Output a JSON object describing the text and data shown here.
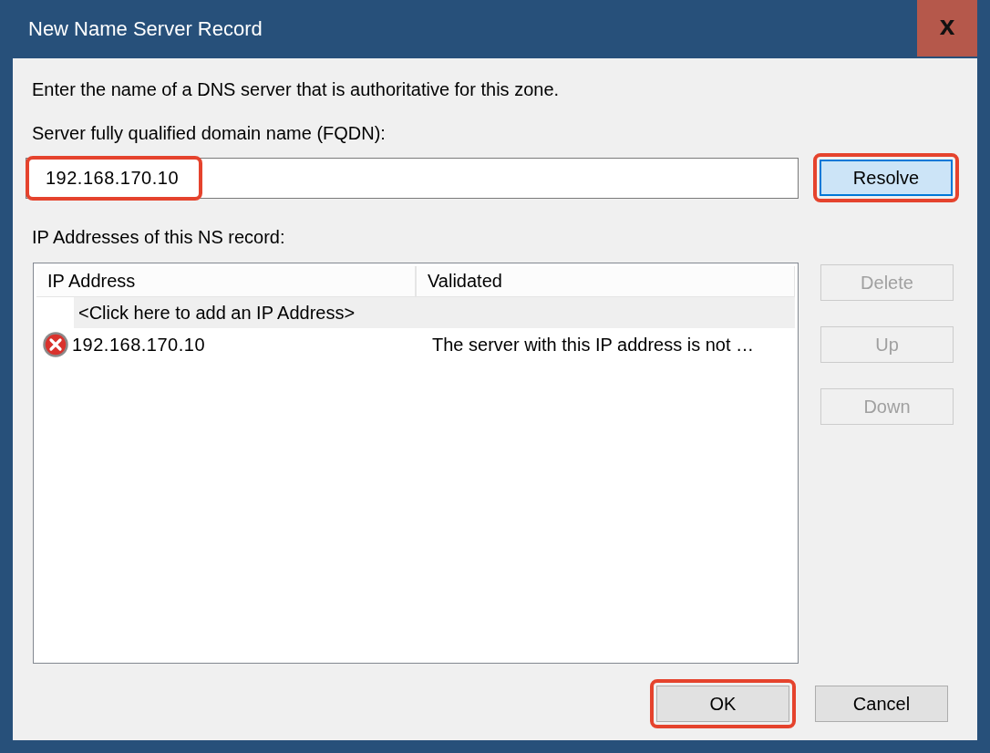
{
  "window": {
    "title": "New Name Server Record",
    "close": "x"
  },
  "intro": "Enter the name of a DNS server that is authoritative for this zone.",
  "fqdn": {
    "label": "Server fully qualified domain name (FQDN):",
    "value": "192.168.170.10",
    "highlighted": true
  },
  "resolve_button": {
    "label": "Resolve",
    "highlighted": true,
    "focused": true
  },
  "list": {
    "label": "IP Addresses of this NS record:",
    "columns": [
      "IP Address",
      "Validated"
    ],
    "add_row": "<Click here to add an IP Address>",
    "rows": [
      {
        "ip": "192.168.170.10",
        "validated": "The server with this IP address is not …",
        "kind": "error"
      }
    ]
  },
  "side_buttons": [
    {
      "label": "Delete",
      "disabled": true
    },
    {
      "label": "Up",
      "disabled": true
    },
    {
      "label": "Down",
      "disabled": true
    }
  ],
  "footer_buttons": [
    {
      "label": "OK",
      "highlighted": true
    },
    {
      "label": "Cancel",
      "highlighted": false
    }
  ]
}
